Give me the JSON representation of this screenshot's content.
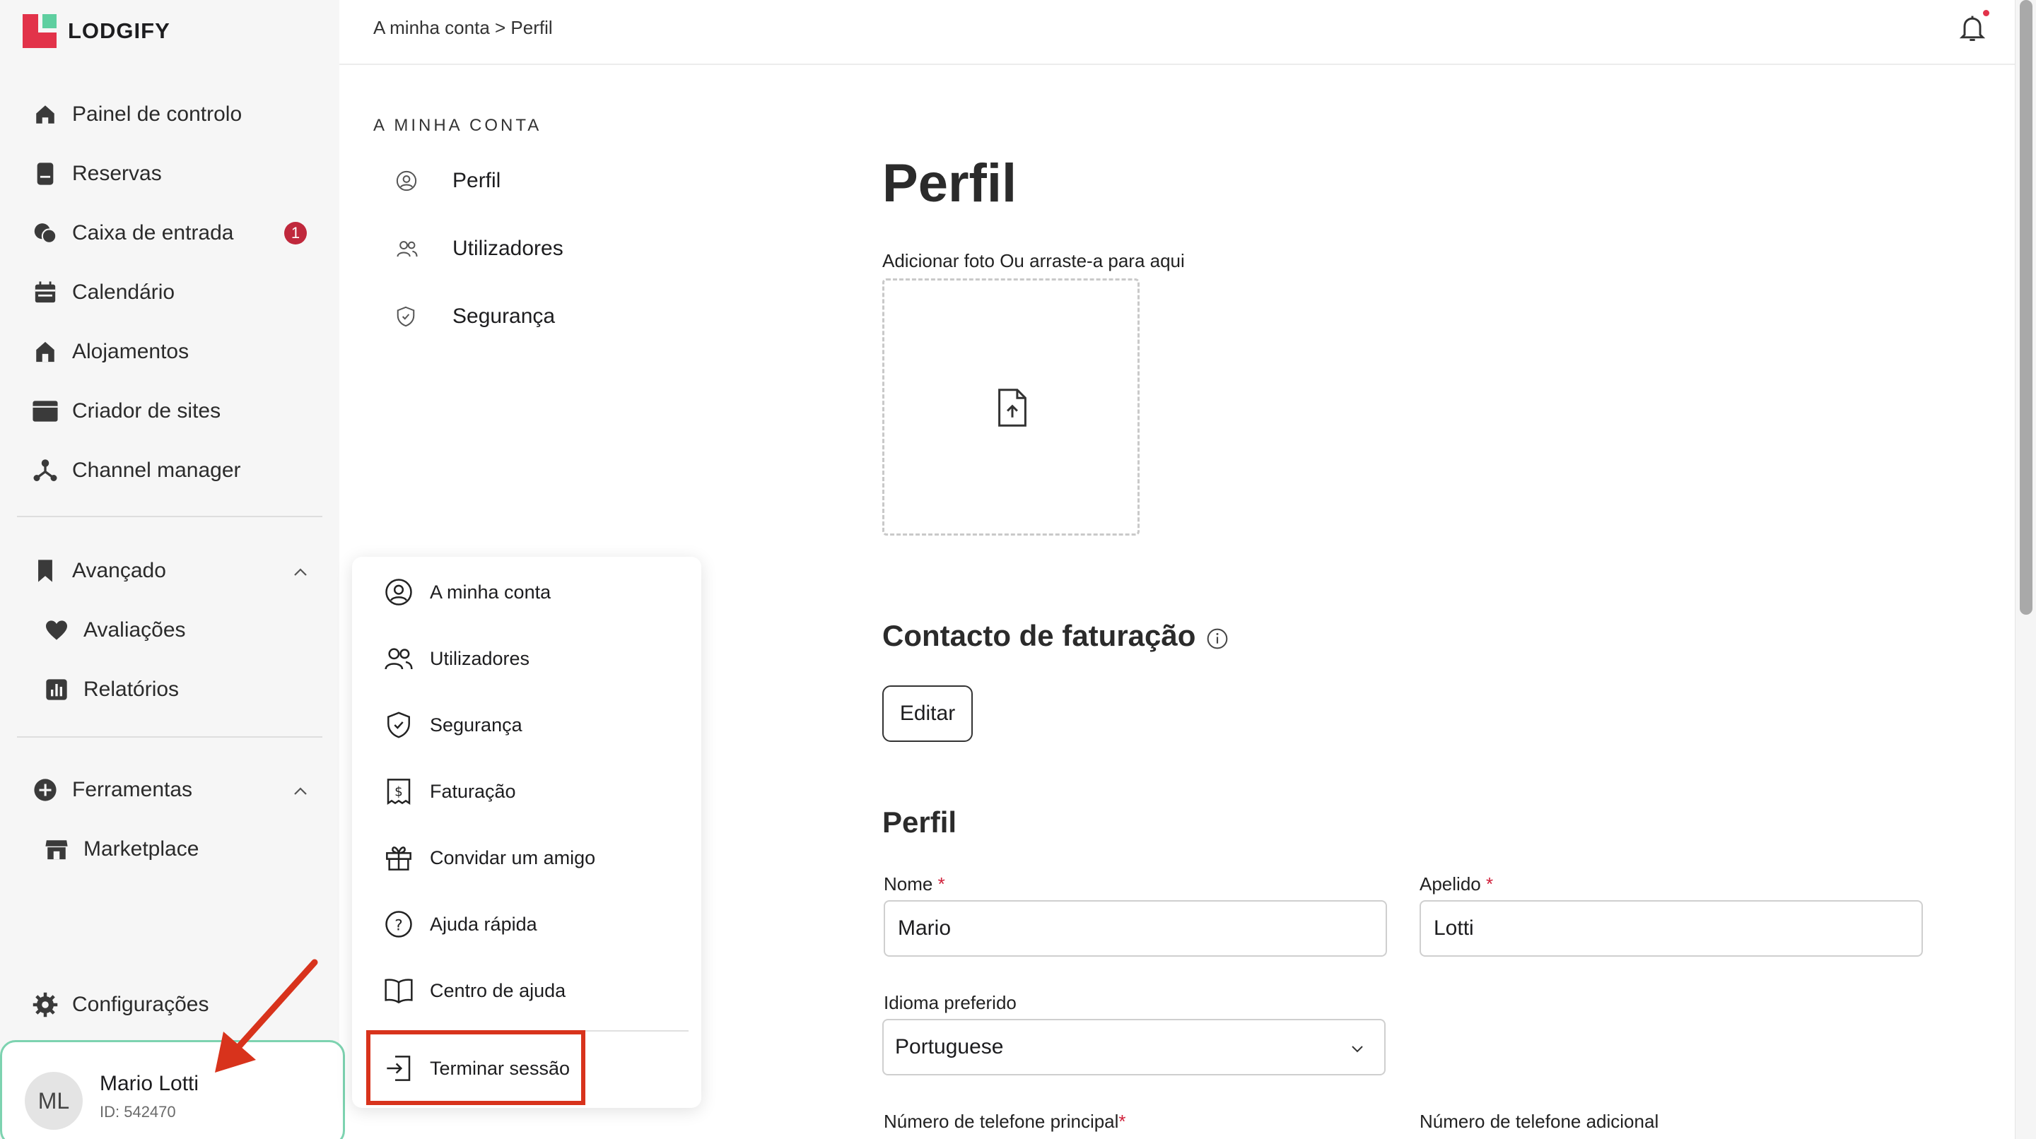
{
  "app": {
    "logo_text": "LODGIFY",
    "brand_color": "#e2334a",
    "accent_color": "#5fcfa0"
  },
  "sidebar": {
    "main_items": [
      {
        "label": "Painel de controlo",
        "icon": "home-icon"
      },
      {
        "label": "Reservas",
        "icon": "book-icon"
      },
      {
        "label": "Caixa de entrada",
        "icon": "chat-icon",
        "badge": "1"
      },
      {
        "label": "Calendário",
        "icon": "calendar-icon"
      },
      {
        "label": "Alojamentos",
        "icon": "house-icon"
      },
      {
        "label": "Criador de sites",
        "icon": "browser-icon"
      },
      {
        "label": "Channel manager",
        "icon": "network-icon"
      }
    ],
    "advanced": {
      "label": "Avançado",
      "items": [
        {
          "label": "Avaliações",
          "icon": "heart-icon"
        },
        {
          "label": "Relatórios",
          "icon": "bar-chart-icon"
        }
      ]
    },
    "tools": {
      "label": "Ferramentas",
      "items": [
        {
          "label": "Marketplace",
          "icon": "store-icon"
        }
      ]
    },
    "settings_label": "Configurações",
    "user": {
      "initials": "ML",
      "name": "Mario Lotti",
      "id_text": "ID: 542470"
    }
  },
  "topbar": {
    "breadcrumb": "A minha conta > Perfil"
  },
  "account_nav": {
    "title": "A MINHA CONTA",
    "items": [
      {
        "label": "Perfil",
        "icon": "user-circle-icon"
      },
      {
        "label": "Utilizadores",
        "icon": "users-icon"
      },
      {
        "label": "Segurança",
        "icon": "shield-icon"
      }
    ]
  },
  "user_menu": {
    "items": [
      {
        "label": "A minha conta",
        "icon": "user-circle-icon"
      },
      {
        "label": "Utilizadores",
        "icon": "users-icon"
      },
      {
        "label": "Segurança",
        "icon": "shield-icon"
      },
      {
        "label": "Faturação",
        "icon": "invoice-icon"
      },
      {
        "label": "Convidar um amigo",
        "icon": "gift-icon"
      },
      {
        "label": "Ajuda rápida",
        "icon": "help-icon"
      },
      {
        "label": "Centro de ajuda",
        "icon": "open-book-icon"
      }
    ],
    "logout_label": "Terminar sessão"
  },
  "main": {
    "page_title": "Perfil",
    "upload_label": "Adicionar foto Ou arraste-a para aqui",
    "billing_title": "Contacto de faturação",
    "edit_label": "Editar",
    "profile_title": "Perfil",
    "fields": {
      "first_name_label": "Nome",
      "first_name_value": "Mario",
      "last_name_label": "Apelido",
      "last_name_value": "Lotti",
      "language_label": "Idioma preferido",
      "language_value": "Portuguese",
      "phone_main_label": "Número de telefone principal",
      "phone_extra_label": "Número de telefone adicional"
    },
    "required_mark": "*"
  }
}
